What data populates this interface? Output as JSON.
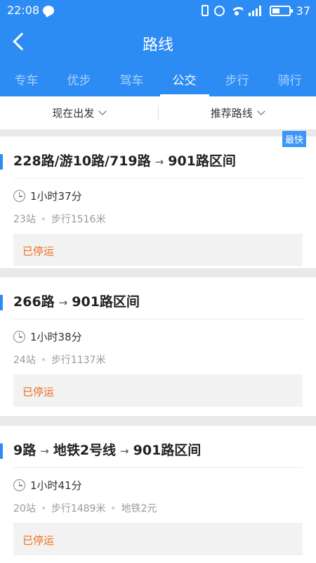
{
  "status_bar": {
    "time": "22:08",
    "battery": "37",
    "icons": [
      "message-icon",
      "vibrate-icon",
      "alarm-icon",
      "wifi-icon",
      "signal-icon",
      "battery-icon"
    ]
  },
  "header": {
    "title": "路线",
    "back_icon": "chevron-left-icon",
    "tabs": [
      "专车",
      "优步",
      "驾车",
      "公交",
      "步行",
      "骑行"
    ],
    "active_tab": "公交"
  },
  "filters": {
    "time": "现在出发",
    "sort": "推荐路线"
  },
  "routes": [
    {
      "badge": "最快",
      "segments": [
        "228路/游10路/719路",
        "901路区间"
      ],
      "duration": "1小时37分",
      "stops": "23站",
      "walk": "步行1516米",
      "extra": "",
      "status": "已停运"
    },
    {
      "badge": "",
      "segments": [
        "266路",
        "901路区间"
      ],
      "duration": "1小时38分",
      "stops": "24站",
      "walk": "步行1137米",
      "extra": "",
      "status": "已停运"
    },
    {
      "badge": "",
      "segments": [
        "9路",
        "地铁2号线",
        "901路区间"
      ],
      "duration": "1小时41分",
      "stops": "20站",
      "walk": "步行1489米",
      "extra": "地铁2元",
      "status": "已停运"
    }
  ],
  "colors": {
    "brand": "#2c8cf4",
    "status_stopped": "#ef6c1f"
  }
}
